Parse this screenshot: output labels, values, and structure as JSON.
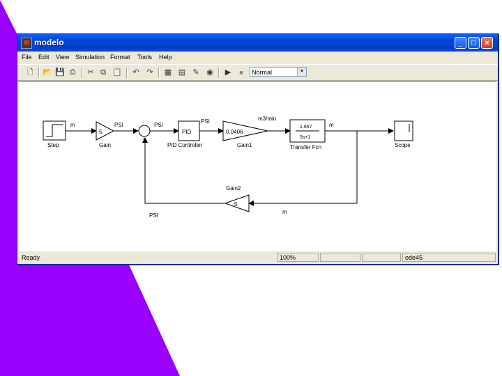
{
  "colors": {
    "background_wedge": "#9900ff",
    "titlebar": "#0046d5"
  },
  "window": {
    "title": "modelo",
    "minimize_label": "_",
    "maximize_label": "□",
    "close_label": "×"
  },
  "menu": {
    "items": [
      "File",
      "Edit",
      "View",
      "Simulation",
      "Format",
      "Tools",
      "Help"
    ]
  },
  "toolbar": {
    "mode_value": "Normal",
    "mode_arrow": "▾",
    "icons": [
      "new-icon",
      "open-icon",
      "save-icon",
      "print-icon",
      "cut-icon",
      "copy-icon",
      "paste-icon",
      "undo-icon",
      "redo-icon",
      "library-browser-icon",
      "model-explorer-icon",
      "debug-icon",
      "target-icon",
      "start-simulation-icon",
      "stop-simulation-icon"
    ]
  },
  "diagram": {
    "blocks": {
      "step": {
        "label": "Step"
      },
      "gain": {
        "label": "Gain",
        "content": "5"
      },
      "pid": {
        "label": "PID Controller",
        "content": "PID"
      },
      "gain1": {
        "label": "Gain1",
        "content": "0.0406"
      },
      "transfer_fcn": {
        "label": "Transfer Fcn",
        "numerator": "1.667",
        "denominator": "5s+1"
      },
      "scope": {
        "label": "Scope"
      },
      "gain2": {
        "label": "Gain2",
        "content": "5"
      }
    },
    "signals": {
      "step_out": "m",
      "gain_out": "PSI",
      "sum_out": "PSI",
      "pid_out": "PSI",
      "gain1_out": "m3/min",
      "tf_out": "m",
      "feedback_in": "m",
      "feedback_out": "PSI"
    },
    "sum_sign": "-"
  },
  "status": {
    "left": "Ready",
    "zoom": "100%",
    "empty1": "",
    "empty2": "",
    "solver": "ode45"
  }
}
